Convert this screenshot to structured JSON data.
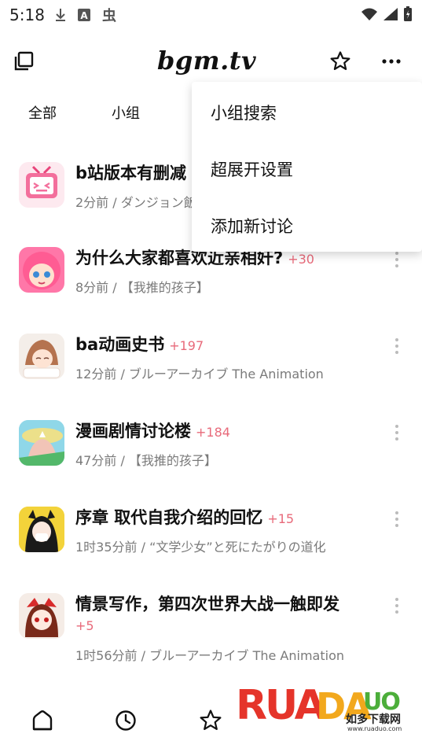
{
  "status_bar": {
    "time": "5:18",
    "icons": [
      "download-icon",
      "a-icon",
      "bug-icon",
      "wifi-icon",
      "signal-icon",
      "battery-icon"
    ]
  },
  "appbar": {
    "logo": "bgm.tv",
    "left_icon": "copy-icon",
    "star_icon": "star-icon",
    "more_icon": "more-horizontal-icon"
  },
  "tabs": [
    "全部",
    "小组"
  ],
  "menu": {
    "items": [
      "小组搜索",
      "超展开设置",
      "添加新讨论"
    ]
  },
  "topics": [
    {
      "title": "b站版本有删减",
      "count": "",
      "subtitle": "2分前 / ダンジョン飯"
    },
    {
      "title": "为什么大家都喜欢近亲相奸?",
      "count": "+30",
      "subtitle": "8分前 / 【我推的孩子】"
    },
    {
      "title": "ba动画史书",
      "count": "+197",
      "subtitle": "12分前 / ブルーアーカイブ The Animation"
    },
    {
      "title": "漫画剧情讨论楼",
      "count": "+184",
      "subtitle": "47分前 / 【我推的孩子】"
    },
    {
      "title": "序章 取代自我介绍的回忆",
      "count": "+15",
      "subtitle": "1时35分前 / “文学少女”と死にたがりの道化"
    },
    {
      "title": "情景写作，第四次世界大战一触即发",
      "count": "+5",
      "subtitle": "1时56分前 / ブルーアーカイブ The Animation"
    }
  ],
  "bottom_nav": [
    "home-icon",
    "clock-icon",
    "star-icon"
  ],
  "watermark": {
    "brand": "RUANDADUO",
    "cn": "如多下载网",
    "url": "www.ruaduo.com"
  },
  "colors": {
    "count_pink": "#e86a7a",
    "subtitle_gray": "#7a7a7a"
  }
}
